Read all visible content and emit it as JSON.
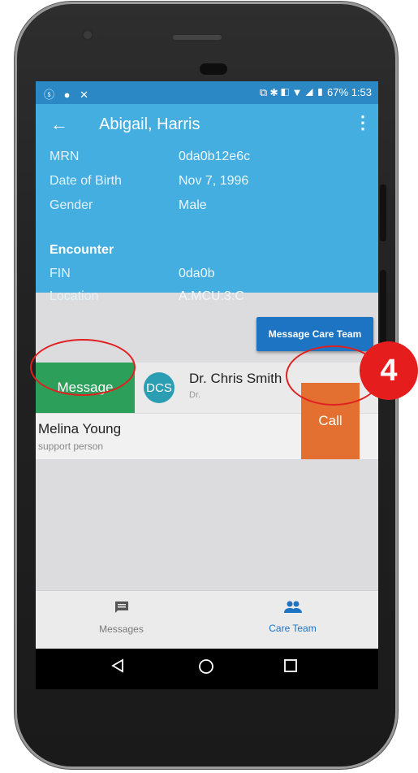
{
  "status_bar": {
    "left_icons": "ⓢ ● ✕",
    "right_text": "⧉ ✱ ◧ ▼ ◢ ▮ 67% 1:53"
  },
  "header": {
    "back_icon": "←",
    "title": "Abigail, Harris",
    "menu_icon": "⋮",
    "fields": [
      {
        "label": "MRN",
        "value": "0da0b12e6c"
      },
      {
        "label": "Date of Birth",
        "value": "Nov 7, 1996"
      },
      {
        "label": "Gender",
        "value": "Male"
      }
    ],
    "encounter_label": "Encounter",
    "encounter_fields": [
      {
        "label": "FIN",
        "value": "0da0b"
      },
      {
        "label": "Location",
        "value": "A:MCU:3:C"
      }
    ]
  },
  "actions": {
    "message_care_team": "Message Care Team"
  },
  "care_team": [
    {
      "initials": "DCS",
      "name": "Dr. Chris Smith",
      "role": "Dr.",
      "action": "Message"
    },
    {
      "name": "Melina Young",
      "role": "support person",
      "action": "Call"
    }
  ],
  "tabs": [
    {
      "label": "Messages",
      "icon": "message-icon"
    },
    {
      "label": "Care Team",
      "icon": "people-icon"
    }
  ],
  "annotation": {
    "step": "4"
  },
  "colors": {
    "status_bar": "#2c88c5",
    "app_bar": "#44aee0",
    "message_button": "#2c9f5a",
    "call_button": "#e36f30",
    "primary_button": "#1c74c2",
    "active_tab": "#1c74c2",
    "highlight": "#e02020"
  }
}
